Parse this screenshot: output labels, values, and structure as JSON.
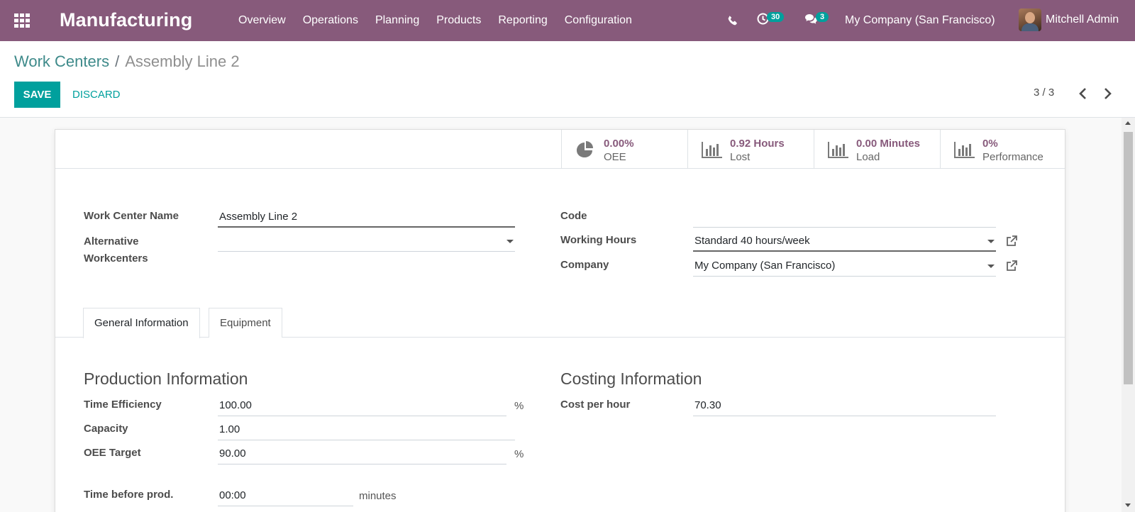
{
  "navbar": {
    "brand": "Manufacturing",
    "menu": [
      "Overview",
      "Operations",
      "Planning",
      "Products",
      "Reporting",
      "Configuration"
    ],
    "activity_count": "30",
    "message_count": "3",
    "company": "My Company (San Francisco)",
    "user": "Mitchell Admin",
    "color": "#875a7b"
  },
  "breadcrumb": {
    "parent": "Work Centers",
    "separator": "/",
    "current": "Assembly Line 2"
  },
  "actions": {
    "save": "SAVE",
    "discard": "DISCARD"
  },
  "pager": {
    "value": "3 / 3"
  },
  "stats": [
    {
      "value": "0.00%",
      "label": "OEE",
      "icon": "pie-chart-icon"
    },
    {
      "value": "0.92 Hours",
      "label": "Lost",
      "icon": "bar-chart-icon"
    },
    {
      "value": "0.00 Minutes",
      "label": "Load",
      "icon": "bar-chart-icon"
    },
    {
      "value": "0%",
      "label": "Performance",
      "icon": "bar-chart-icon"
    }
  ],
  "form": {
    "name_label": "Work Center Name",
    "name_value": "Assembly Line 2",
    "alt_label_1": "Alternative",
    "alt_label_2": "Workcenters",
    "alt_value": "",
    "code_label": "Code",
    "code_value": "",
    "hours_label": "Working Hours",
    "hours_value": "Standard 40 hours/week",
    "company_label": "Company",
    "company_value": "My Company (San Francisco)"
  },
  "tabs": [
    "General Information",
    "Equipment"
  ],
  "production": {
    "title": "Production Information",
    "efficiency_label": "Time Efficiency",
    "efficiency_value": "100.00",
    "efficiency_unit": "%",
    "capacity_label": "Capacity",
    "capacity_value": "1.00",
    "oee_label": "OEE Target",
    "oee_value": "90.00",
    "oee_unit": "%",
    "time_before_label": "Time before prod.",
    "time_before_value": "00:00",
    "time_before_unit": "minutes"
  },
  "costing": {
    "title": "Costing Information",
    "cost_label": "Cost per hour",
    "cost_value": "70.30"
  },
  "colors": {
    "accent": "#00a09d",
    "stat_value": "#875a7b"
  }
}
